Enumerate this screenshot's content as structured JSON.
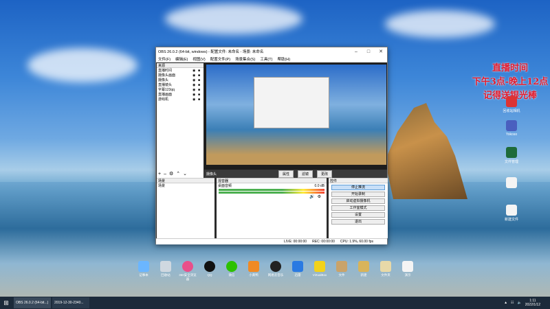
{
  "promo": {
    "line1": "直播时间",
    "line2": "下午3点-晚上12点",
    "line3": "记得送银光棒"
  },
  "desktop_icons": [
    "回收站相机",
    "Yokoso",
    "文件管理",
    "",
    "新建文件"
  ],
  "obs": {
    "title": "OBS 26.0.2 (64-bit, windows) - 配置文件: 未命名 - 场景: 未命名",
    "menus": [
      "文件(F)",
      "编辑(E)",
      "视图(V)",
      "配置文件(P)",
      "场景集合(S)",
      "工具(T)",
      "帮助(H)"
    ],
    "sources_header": "来源",
    "sources": [
      "直播时间",
      "摄像头画面",
      "摄像头",
      "直播镜头",
      "字幕123qq",
      "直播画面",
      "游戏机"
    ],
    "toolbar": {
      "label": "摄像头",
      "props": "属性",
      "filters": "滤镜",
      "defaults": "更改"
    },
    "scenes_header": "场景",
    "scene": "场景",
    "mixer_header": "混音器",
    "mixer_item": "桌面音频",
    "mixer_db": "0.0 dB",
    "controls_header": "控件",
    "controls": [
      "停止推流",
      "开始录制",
      "启动虚拟摄像机",
      "工作室模式",
      "设置",
      "退出"
    ],
    "status": {
      "live": "LIVE: 00:00:00",
      "rec": "REC: 00:00:00",
      "cpu": "CPU: 1.9%, 60.00 fps"
    }
  },
  "taskbar_icons": [
    "记事本",
    "回收站",
    "360安全浏览器",
    "QQ",
    "微信",
    "小黄鸭",
    "网易云音乐",
    "迅雷",
    "VirtualBox",
    "文件",
    "新建",
    "文件夹",
    "演示"
  ],
  "taskbar": {
    "task1": "OBS 26.0.2 (64-bit...)",
    "task2": "2019-12-30-2340...",
    "time": "1:11",
    "date": "2022/1/12"
  },
  "colors": {
    "accent": "#5b9bd5",
    "promo": "#e01b2e",
    "taskbar": "#1c2a3a"
  }
}
